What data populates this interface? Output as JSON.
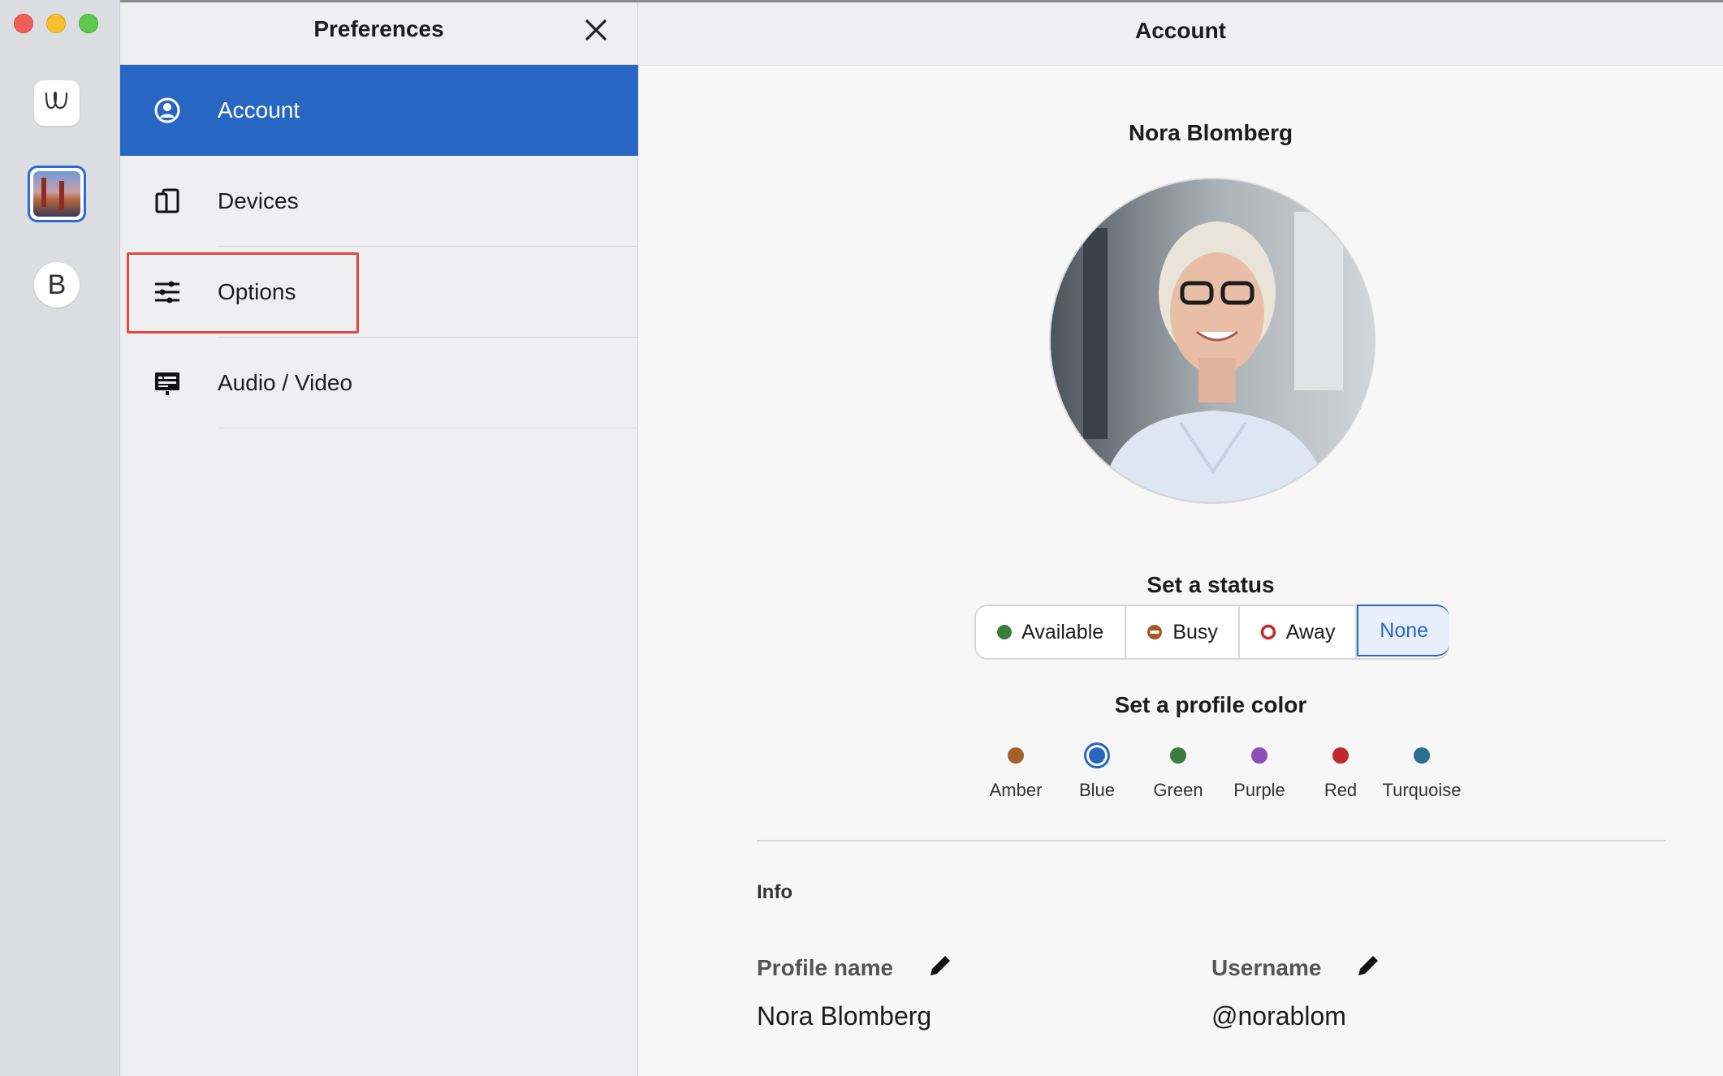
{
  "window": {
    "traffic_lights": [
      "close",
      "minimize",
      "zoom"
    ]
  },
  "rail": {
    "apps": [
      {
        "name": "wire-logo",
        "glyph": "ꟺ"
      },
      {
        "name": "team-photo",
        "glyph": ""
      },
      {
        "name": "team-b",
        "glyph": "B"
      }
    ]
  },
  "preferences": {
    "title": "Preferences",
    "close_icon": "close-icon",
    "items": [
      {
        "label": "Account",
        "icon": "account-icon",
        "active": true
      },
      {
        "label": "Devices",
        "icon": "devices-icon",
        "active": false
      },
      {
        "label": "Options",
        "icon": "options-icon",
        "active": false,
        "highlighted": true
      },
      {
        "label": "Audio / Video",
        "icon": "audio-video-icon",
        "active": false
      }
    ]
  },
  "account": {
    "header": "Account",
    "user_name": "Nora Blomberg",
    "status_title": "Set a status",
    "statuses": [
      {
        "label": "Available",
        "color": "#3a7d3e",
        "icon": "available-dot"
      },
      {
        "label": "Busy",
        "color": "#a35a1f",
        "icon": "busy-icon"
      },
      {
        "label": "Away",
        "color": "#c0282d",
        "icon": "away-icon"
      },
      {
        "label": "None",
        "selected": true
      }
    ],
    "color_title": "Set a profile color",
    "colors": [
      {
        "name": "Amber",
        "hex": "#a4622a"
      },
      {
        "name": "Blue",
        "hex": "#2866c4",
        "selected": true
      },
      {
        "name": "Green",
        "hex": "#3a7d3e"
      },
      {
        "name": "Purple",
        "hex": "#8b4fb5"
      },
      {
        "name": "Red",
        "hex": "#c0282d"
      },
      {
        "name": "Turquoise",
        "hex": "#2a6f8e"
      }
    ],
    "info_label": "Info",
    "profile_name_label": "Profile name",
    "profile_name_value": "Nora Blomberg",
    "username_label": "Username",
    "username_value": "@norablom"
  },
  "colors": {
    "accent": "#2866c4",
    "highlight_box": "#e0493c"
  }
}
